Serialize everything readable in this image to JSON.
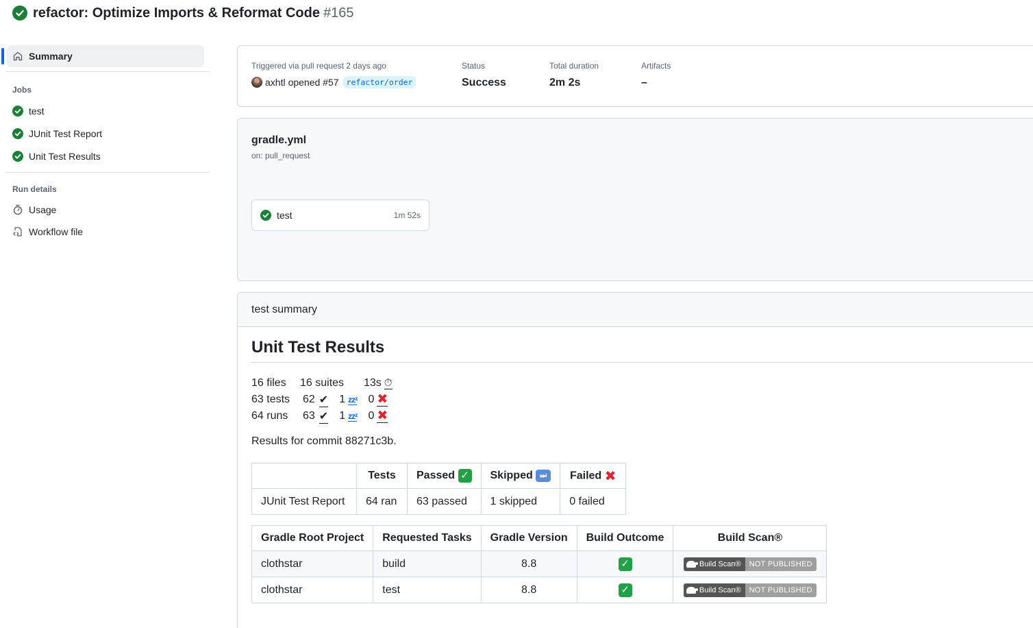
{
  "header": {
    "title": "refactor: Optimize Imports & Reformat Code",
    "run_number": "#165"
  },
  "sidebar": {
    "summary_label": "Summary",
    "jobs_heading": "Jobs",
    "jobs": [
      {
        "label": "test",
        "status": "success"
      },
      {
        "label": "JUnit Test Report",
        "status": "success"
      },
      {
        "label": "Unit Test Results",
        "status": "success"
      }
    ],
    "run_details_heading": "Run details",
    "run_details": [
      {
        "label": "Usage",
        "icon": "stopwatch-icon"
      },
      {
        "label": "Workflow file",
        "icon": "file-code-icon"
      }
    ]
  },
  "trigger": {
    "label": "Triggered via pull request 2 days ago",
    "user": "axhtl",
    "action": "opened #57",
    "branch": "refactor/order",
    "status_label": "Status",
    "status_value": "Success",
    "duration_label": "Total duration",
    "duration_value": "2m 2s",
    "artifacts_label": "Artifacts",
    "artifacts_value": "–"
  },
  "workflow": {
    "file": "gradle.yml",
    "on": "on: pull_request",
    "job_name": "test",
    "job_duration": "1m 52s"
  },
  "summary": {
    "heading": "test summary",
    "title": "Unit Test Results",
    "line1": {
      "files": "16 files",
      "suites": "16 suites",
      "time": "13s"
    },
    "line2": {
      "total": "63 tests",
      "passed": "62",
      "skipped": "1",
      "failed": "0"
    },
    "line3": {
      "total": "64 runs",
      "passed": "63",
      "skipped": "1",
      "failed": "0"
    },
    "commit_text": "Results for commit 88271c3b.",
    "table1": {
      "headers": [
        "",
        "Tests",
        "Passed",
        "Skipped",
        "Failed"
      ],
      "row": [
        "JUnit Test Report",
        "64 ran",
        "63 passed",
        "1 skipped",
        "0 failed"
      ]
    },
    "table2": {
      "headers": [
        "Gradle Root Project",
        "Requested Tasks",
        "Gradle Version",
        "Build Outcome",
        "Build Scan®"
      ],
      "rows": [
        {
          "project": "clothstar",
          "task": "build",
          "version": "8.8",
          "badge_left": "Build Scan®",
          "badge_right": "NOT PUBLISHED"
        },
        {
          "project": "clothstar",
          "task": "test",
          "version": "8.8",
          "badge_left": "Build Scan®",
          "badge_right": "NOT PUBLISHED"
        }
      ]
    }
  },
  "colors": {
    "success": "#1a7f37",
    "accent": "#0969da",
    "fail": "#e0232e"
  }
}
